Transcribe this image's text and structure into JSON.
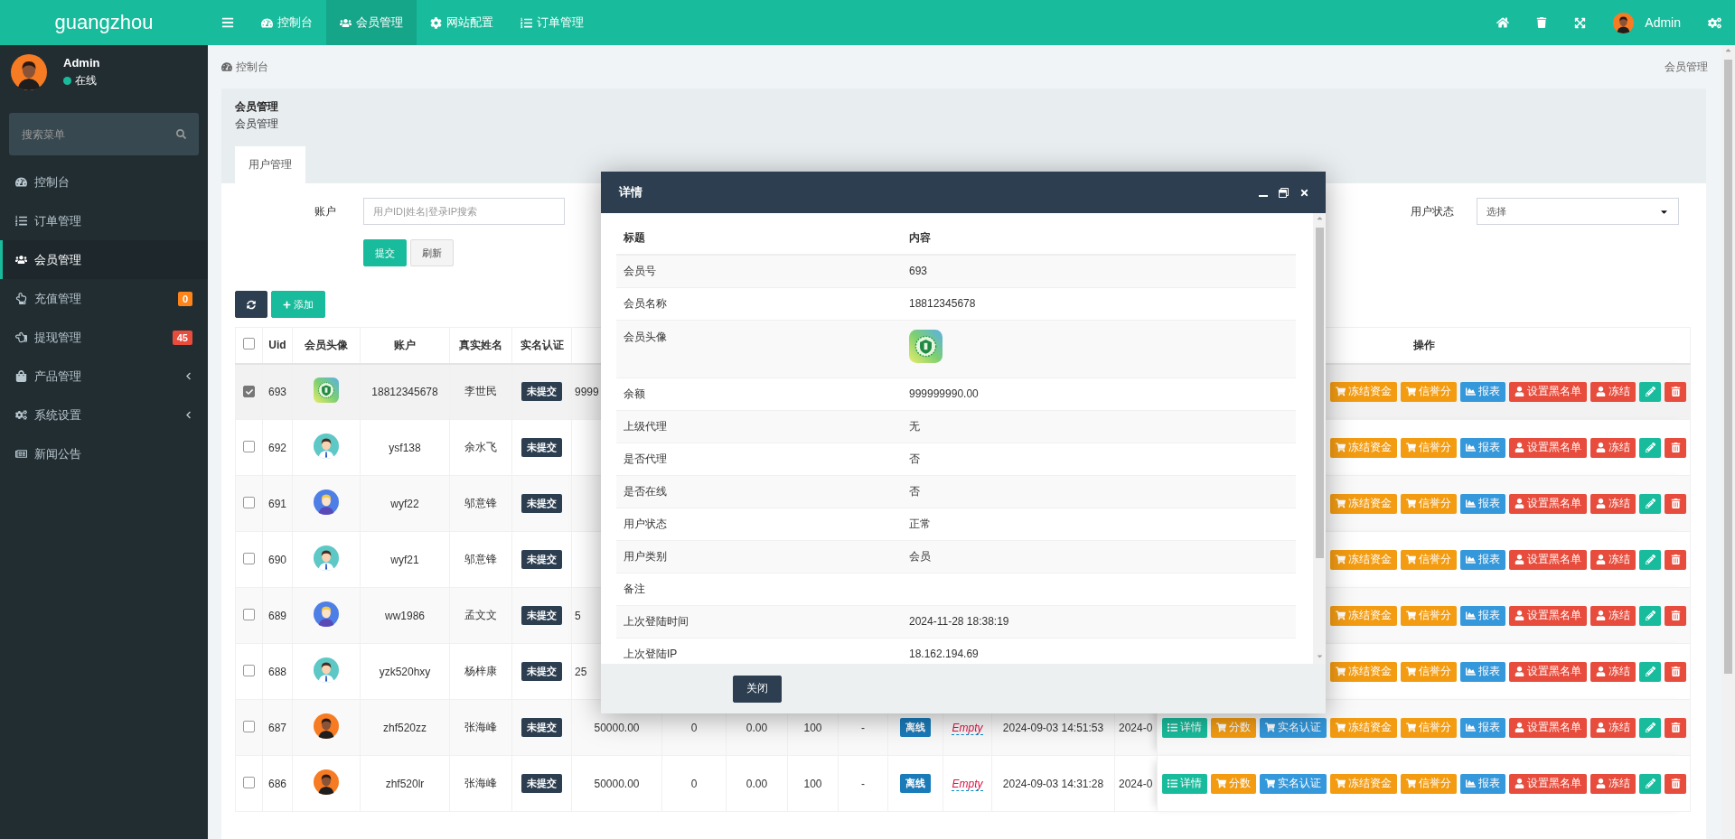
{
  "topbar": {
    "logo": "guangzhou",
    "nav": [
      {
        "label": "控制台",
        "kind": "dashboard",
        "selected": false
      },
      {
        "label": "会员管理",
        "kind": "users",
        "selected": true
      },
      {
        "label": "网站配置",
        "kind": "gear",
        "selected": false
      },
      {
        "label": "订单管理",
        "kind": "list",
        "selected": false
      }
    ],
    "user": {
      "name": "Admin",
      "avatar": {
        "kind": "dark"
      }
    }
  },
  "sidebar": {
    "user": {
      "name": "Admin",
      "status": "在线",
      "online": true,
      "avatar": {
        "kind": "dark"
      }
    },
    "search": {
      "placeholder": "搜索菜单"
    },
    "items": [
      {
        "label": "控制台",
        "kind": "dashboard",
        "selected": false,
        "submenu": false
      },
      {
        "label": "订单管理",
        "kind": "list",
        "selected": false,
        "submenu": false
      },
      {
        "label": "会员管理",
        "kind": "users",
        "selected": true,
        "submenu": false
      },
      {
        "label": "充值管理",
        "kind": "hand-up",
        "selected": false,
        "submenu": false,
        "badge": {
          "text": "0",
          "color": "#ff851b"
        }
      },
      {
        "label": "提现管理",
        "kind": "hand-left",
        "selected": false,
        "submenu": false,
        "badge": {
          "text": "45",
          "color": "#e74c3c"
        }
      },
      {
        "label": "产品管理",
        "kind": "bag",
        "selected": false,
        "submenu": true
      },
      {
        "label": "系统设置",
        "kind": "gears",
        "selected": false,
        "submenu": true
      },
      {
        "label": "新闻公告",
        "kind": "news",
        "selected": false,
        "submenu": false
      }
    ]
  },
  "breadcrumb": {
    "left": "控制台",
    "right": "会员管理"
  },
  "panel": {
    "title": "会员管理",
    "subtitle": "会员管理",
    "tabs": [
      {
        "label": "用户管理",
        "selected": true
      }
    ]
  },
  "filters": {
    "account": {
      "label": "账户",
      "placeholder": "用户ID|姓名|登录IP搜索"
    },
    "buttons": [
      {
        "label": "提交",
        "kind": "primary"
      },
      {
        "label": "刷新",
        "kind": "default"
      }
    ],
    "status": {
      "label": "用户状态",
      "value": "选择"
    }
  },
  "toolbar": {
    "add": "添加"
  },
  "table": {
    "header_checked": false,
    "columns": [
      "Uid",
      "会员头像",
      "账户",
      "真实姓名",
      "实名认证"
    ],
    "actions_column": "操作",
    "rows": [
      {
        "checked": true,
        "uid": "693",
        "avatar": {
          "kind": "logo"
        },
        "account": "18812345678",
        "name": "李世民",
        "verify": "未提交",
        "cells": {
          "column_7": "9999"
        },
        "actions": [
          {
            "label": "冻结资金",
            "kind": "freeze-funds"
          },
          {
            "label": "信誉分",
            "kind": "credit"
          },
          {
            "label": "报表",
            "kind": "report"
          },
          {
            "label": "设置黑名单",
            "kind": "blacklist"
          },
          {
            "label": "冻结",
            "kind": "freeze"
          },
          {
            "kind": "edit"
          },
          {
            "kind": "delete"
          }
        ]
      },
      {
        "checked": false,
        "uid": "692",
        "avatar": {
          "kind": "man"
        },
        "account": "ysf138",
        "name": "余水飞",
        "verify": "未提交",
        "cells": {},
        "actions": [
          {
            "label": "冻结资金",
            "kind": "freeze-funds"
          },
          {
            "label": "信誉分",
            "kind": "credit"
          },
          {
            "label": "报表",
            "kind": "report"
          },
          {
            "label": "设置黑名单",
            "kind": "blacklist"
          },
          {
            "label": "冻结",
            "kind": "freeze"
          },
          {
            "kind": "edit"
          },
          {
            "kind": "delete"
          }
        ]
      },
      {
        "checked": false,
        "uid": "691",
        "avatar": {
          "kind": "blond"
        },
        "account": "wyf22",
        "name": "邬意锋",
        "verify": "未提交",
        "cells": {},
        "actions": [
          {
            "label": "冻结资金",
            "kind": "freeze-funds"
          },
          {
            "label": "信誉分",
            "kind": "credit"
          },
          {
            "label": "报表",
            "kind": "report"
          },
          {
            "label": "设置黑名单",
            "kind": "blacklist"
          },
          {
            "label": "冻结",
            "kind": "freeze"
          },
          {
            "kind": "edit"
          },
          {
            "kind": "delete"
          }
        ]
      },
      {
        "checked": false,
        "uid": "690",
        "avatar": {
          "kind": "man"
        },
        "account": "wyf21",
        "name": "邬意锋",
        "verify": "未提交",
        "cells": {},
        "actions": [
          {
            "label": "冻结资金",
            "kind": "freeze-funds"
          },
          {
            "label": "信誉分",
            "kind": "credit"
          },
          {
            "label": "报表",
            "kind": "report"
          },
          {
            "label": "设置黑名单",
            "kind": "blacklist"
          },
          {
            "label": "冻结",
            "kind": "freeze"
          },
          {
            "kind": "edit"
          },
          {
            "kind": "delete"
          }
        ]
      },
      {
        "checked": false,
        "uid": "689",
        "avatar": {
          "kind": "blond"
        },
        "account": "ww1986",
        "name": "孟文文",
        "verify": "未提交",
        "cells": {
          "column_7": "5"
        },
        "actions": [
          {
            "label": "冻结资金",
            "kind": "freeze-funds"
          },
          {
            "label": "信誉分",
            "kind": "credit"
          },
          {
            "label": "报表",
            "kind": "report"
          },
          {
            "label": "设置黑名单",
            "kind": "blacklist"
          },
          {
            "label": "冻结",
            "kind": "freeze"
          },
          {
            "kind": "edit"
          },
          {
            "kind": "delete"
          }
        ]
      },
      {
        "checked": false,
        "uid": "688",
        "avatar": {
          "kind": "man"
        },
        "account": "yzk520hxy",
        "name": "杨梓康",
        "verify": "未提交",
        "cells": {
          "column_7": "25"
        },
        "actions": [
          {
            "label": "冻结资金",
            "kind": "freeze-funds"
          },
          {
            "label": "信誉分",
            "kind": "credit"
          },
          {
            "label": "报表",
            "kind": "report"
          },
          {
            "label": "设置黑名单",
            "kind": "blacklist"
          },
          {
            "label": "冻结",
            "kind": "freeze"
          },
          {
            "kind": "edit"
          },
          {
            "kind": "delete"
          }
        ]
      },
      {
        "checked": false,
        "uid": "687",
        "avatar": {
          "kind": "dark"
        },
        "account": "zhf520zz",
        "name": "张海峰",
        "verify": "未提交",
        "cells": {
          "column_7": "50000.00",
          "column_8": "0",
          "column_9": "0.00",
          "column_10": "100",
          "column_11": "-",
          "column_12": "离线",
          "column_13": "Empty",
          "column_14": "2024-09-03 14:51:53",
          "column_15": "2024-0"
        },
        "actions": [
          {
            "label": "详情",
            "kind": "detail"
          },
          {
            "label": "分数",
            "kind": "score"
          },
          {
            "label": "实名认证",
            "kind": "verify"
          },
          {
            "label": "冻结资金",
            "kind": "freeze-funds"
          },
          {
            "label": "信誉分",
            "kind": "credit"
          },
          {
            "label": "报表",
            "kind": "report"
          },
          {
            "label": "设置黑名单",
            "kind": "blacklist"
          },
          {
            "label": "冻结",
            "kind": "freeze"
          },
          {
            "kind": "edit"
          },
          {
            "kind": "delete"
          }
        ]
      },
      {
        "checked": false,
        "uid": "686",
        "avatar": {
          "kind": "dark"
        },
        "account": "zhf520lr",
        "name": "张海峰",
        "verify": "未提交",
        "cells": {
          "column_7": "50000.00",
          "column_8": "0",
          "column_9": "0.00",
          "column_10": "100",
          "column_11": "-",
          "column_12": "离线",
          "column_13": "Empty",
          "column_14": "2024-09-03 14:31:28",
          "column_15": "2024-0"
        },
        "actions": [
          {
            "label": "详情",
            "kind": "detail"
          },
          {
            "label": "分数",
            "kind": "score"
          },
          {
            "label": "实名认证",
            "kind": "verify"
          },
          {
            "label": "冻结资金",
            "kind": "freeze-funds"
          },
          {
            "label": "信誉分",
            "kind": "credit"
          },
          {
            "label": "报表",
            "kind": "report"
          },
          {
            "label": "设置黑名单",
            "kind": "blacklist"
          },
          {
            "label": "冻结",
            "kind": "freeze"
          },
          {
            "kind": "edit"
          },
          {
            "kind": "delete"
          }
        ]
      }
    ]
  },
  "dialog": {
    "title": "详情",
    "columns": [
      "标题",
      "内容"
    ],
    "rows": [
      {
        "label": "会员号",
        "value": "693"
      },
      {
        "label": "会员名称",
        "value": "18812345678"
      },
      {
        "label": "会员头像",
        "avatar": {
          "kind": "logo"
        }
      },
      {
        "label": "余额",
        "value": "999999990.00"
      },
      {
        "label": "上级代理",
        "value": "无"
      },
      {
        "label": "是否代理",
        "value": "否"
      },
      {
        "label": "是否在线",
        "value": "否"
      },
      {
        "label": "用户状态",
        "value": "正常"
      },
      {
        "label": "用户类别",
        "value": "会员"
      },
      {
        "label": "备注"
      },
      {
        "label": "上次登陆时间",
        "value": "2024-11-28 18:38:19"
      },
      {
        "label": "上次登陆IP",
        "value": "18.162.194.69"
      }
    ],
    "close": "关闭"
  }
}
